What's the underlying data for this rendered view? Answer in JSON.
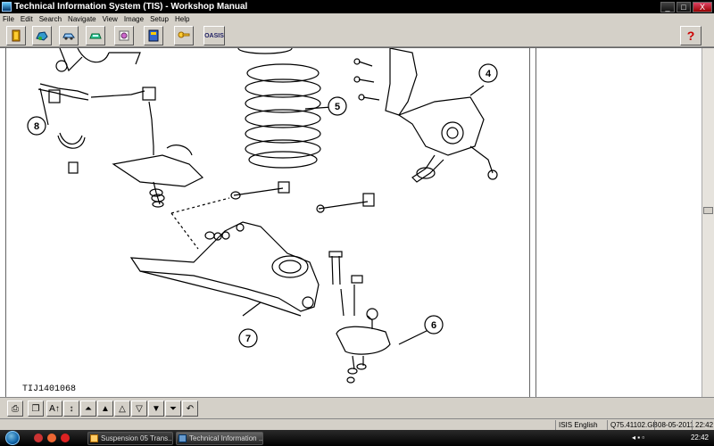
{
  "window": {
    "title": "Technical Information System (TIS) - Workshop Manual",
    "controls": [
      "_",
      "□",
      "X"
    ]
  },
  "menu": [
    "File",
    "Edit",
    "Search",
    "Navigate",
    "View",
    "Image",
    "Setup",
    "Help"
  ],
  "toolbar": {
    "buttons": [
      {
        "name": "exit-icon"
      },
      {
        "name": "vehicle-icon"
      },
      {
        "name": "car-side-icon"
      },
      {
        "name": "car-front-icon"
      },
      {
        "name": "component-icon"
      },
      {
        "name": "book-icon"
      },
      {
        "name": "key-icon"
      },
      {
        "name": "oasis-icon",
        "label": "OASIS"
      }
    ],
    "help_label": "?"
  },
  "diagram": {
    "code": "TIJ1401068",
    "callouts": [
      "4",
      "5",
      "6",
      "7",
      "8"
    ]
  },
  "navbar": {
    "buttons": [
      "print-icon",
      "copy-icon",
      "zoom-in-icon",
      "first-page-icon",
      "prev-page-icon",
      "next-page-icon",
      "last-page-icon",
      "up-icon",
      "down-icon",
      "back-icon"
    ]
  },
  "status": {
    "language": "ISIS English",
    "release": "Q75.41102.GB",
    "date": "08-05-2011",
    "time": "22:42"
  },
  "taskbar": {
    "tasks": [
      "Suspension 05 Trans...",
      "Technical Information ..."
    ],
    "tray_time": "22:42"
  }
}
